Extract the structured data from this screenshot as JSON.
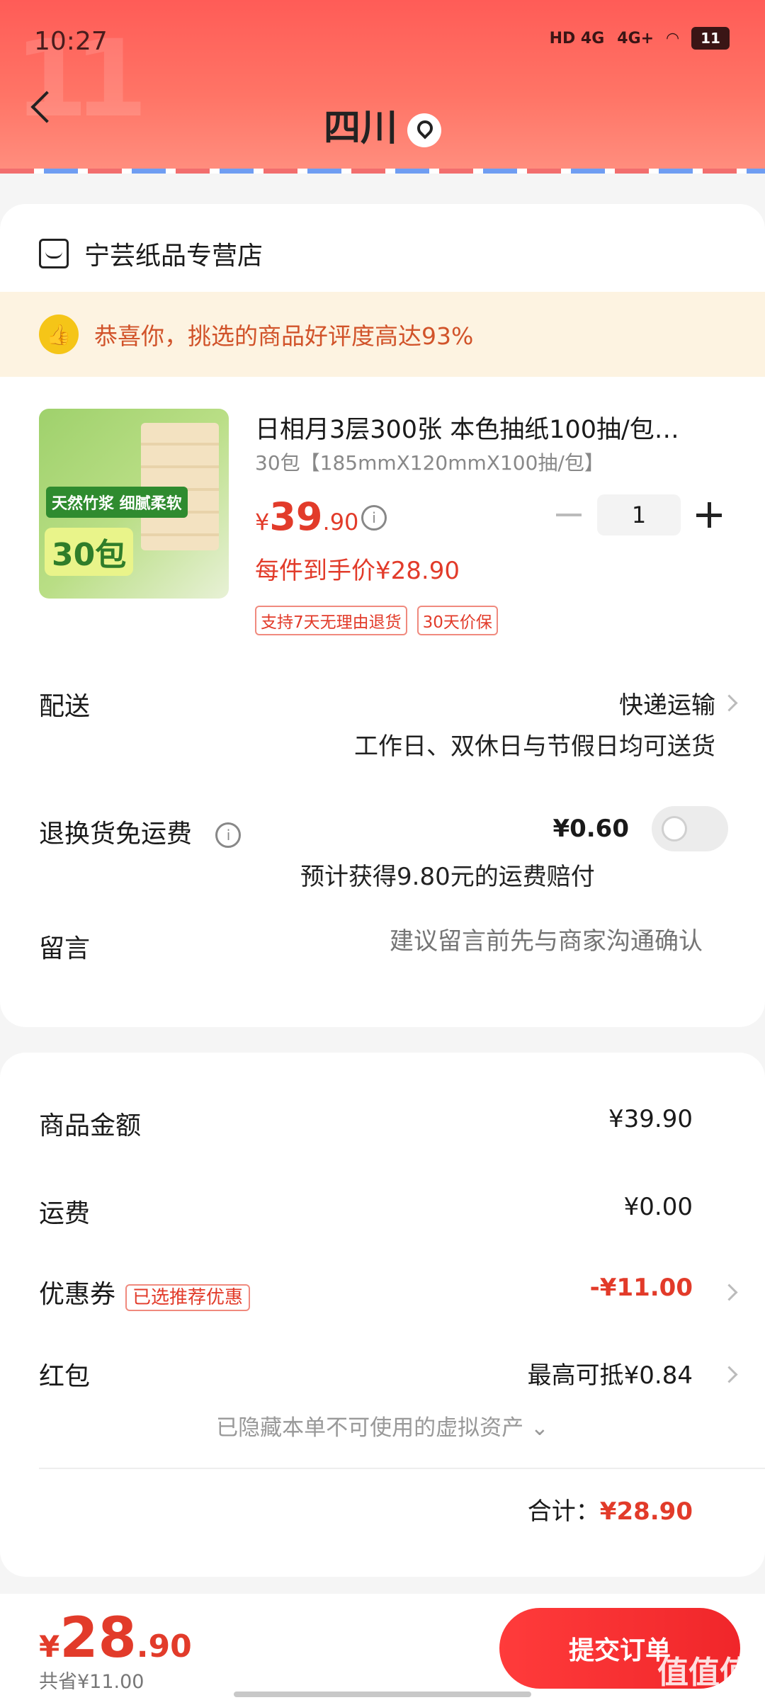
{
  "status": {
    "time": "10:27",
    "net1": "HD 4G",
    "net2": "4G+",
    "battery": "11"
  },
  "header": {
    "region": "四川"
  },
  "store": {
    "name": "宁芸纸品专营店"
  },
  "banner": {
    "text": "恭喜你，挑选的商品好评度高达93%"
  },
  "product": {
    "title": "日相月3层300张 本色抽纸100抽/包…",
    "spec": "30包【185mmX120mmX100抽/包】",
    "price_currency": "¥",
    "price_int": "39",
    "price_dec": ".90",
    "quantity": "1",
    "unit_price": "每件到手价¥28.90",
    "tags": [
      "支持7天无理由退货",
      "30天价保"
    ],
    "image_text": {
      "bubble": "天然竹浆 细腻柔软",
      "big": "30包"
    }
  },
  "delivery": {
    "label": "配送",
    "method": "快递运输",
    "note": "工作日、双休日与节假日均可送货"
  },
  "return_insurance": {
    "label": "退换货免运费",
    "price": "¥0.60",
    "note": "预计获得9.80元的运费赔付"
  },
  "message": {
    "label": "留言",
    "placeholder": "建议留言前先与商家沟通确认"
  },
  "summary": {
    "goods_label": "商品金额",
    "goods_value": "¥39.90",
    "shipping_label": "运费",
    "shipping_value": "¥0.00",
    "coupon_label": "优惠券",
    "coupon_badge": "已选推荐优惠",
    "coupon_value": "-¥11.00",
    "redpacket_label": "红包",
    "redpacket_value": "最高可抵¥0.84",
    "hidden_assets": "已隐藏本单不可使用的虚拟资产 ⌄",
    "total_label": "合计：",
    "total_value": "¥28.90"
  },
  "checkout": {
    "currency": "¥",
    "int": "28",
    "dec": ".90",
    "saved": "共省¥11.00",
    "submit": "提交订单",
    "watermark": "值值值"
  },
  "colors": {
    "accent": "#e23b2a",
    "header": "#ff6a5f"
  }
}
